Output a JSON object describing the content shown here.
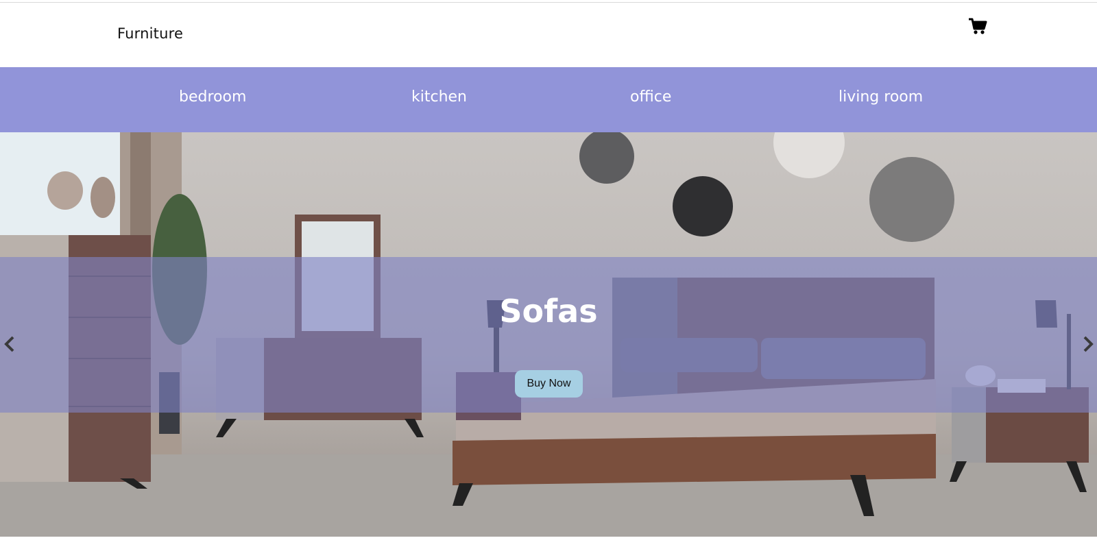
{
  "header": {
    "brand": "Furniture",
    "cart_icon": "shopping-cart-icon"
  },
  "nav": {
    "items": [
      {
        "label": "bedroom"
      },
      {
        "label": "kitchen"
      },
      {
        "label": "office"
      },
      {
        "label": "living room"
      }
    ]
  },
  "hero": {
    "title": "Sofas",
    "button_label": "Buy Now",
    "prev_icon": "chevron-left-icon",
    "next_icon": "chevron-right-icon",
    "image": "bedroom-furniture-photo"
  },
  "colors": {
    "nav_background": "#9194d9",
    "overlay": "#8083c4",
    "button": "#a6cfe3",
    "text_light": "#ffffff"
  }
}
